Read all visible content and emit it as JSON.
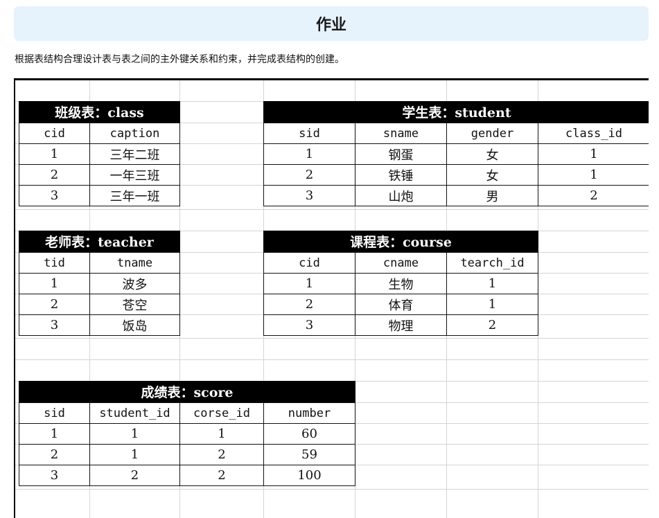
{
  "banner": {
    "title": "作业"
  },
  "description": "根据表结构合理设计表与表之间的主外键关系和约束，并完成表结构的创建。",
  "tables": {
    "class": {
      "title": "班级表：class",
      "columns": [
        "cid",
        "caption"
      ],
      "rows": [
        [
          "1",
          "三年二班"
        ],
        [
          "2",
          "一年三班"
        ],
        [
          "3",
          "三年一班"
        ]
      ]
    },
    "student": {
      "title": "学生表：student",
      "columns": [
        "sid",
        "sname",
        "gender",
        "class_id"
      ],
      "rows": [
        [
          "1",
          "钢蛋",
          "女",
          "1"
        ],
        [
          "2",
          "铁锤",
          "女",
          "1"
        ],
        [
          "3",
          "山炮",
          "男",
          "2"
        ]
      ]
    },
    "teacher": {
      "title": "老师表：teacher",
      "columns": [
        "tid",
        "tname"
      ],
      "rows": [
        [
          "1",
          "波多"
        ],
        [
          "2",
          "苍空"
        ],
        [
          "3",
          "饭岛"
        ]
      ]
    },
    "course": {
      "title": "课程表：course",
      "columns": [
        "cid",
        "cname",
        "tearch_id"
      ],
      "rows": [
        [
          "1",
          "生物",
          "1"
        ],
        [
          "2",
          "体育",
          "1"
        ],
        [
          "3",
          "物理",
          "2"
        ]
      ]
    },
    "score": {
      "title": "成绩表：score",
      "columns": [
        "sid",
        "student_id",
        "corse_id",
        "number"
      ],
      "rows": [
        [
          "1",
          "1",
          "1",
          "60"
        ],
        [
          "2",
          "1",
          "2",
          "59"
        ],
        [
          "3",
          "2",
          "2",
          "100"
        ]
      ]
    }
  }
}
